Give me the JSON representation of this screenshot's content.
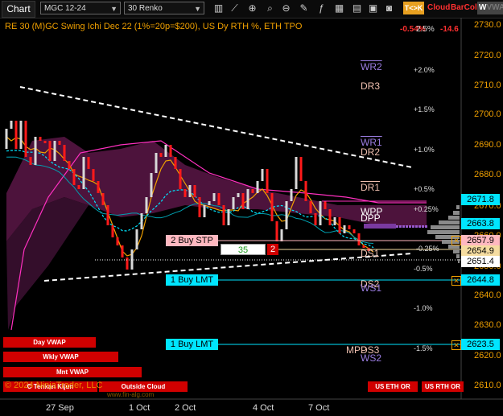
{
  "toolbar": {
    "chart_label": "Chart",
    "symbol": "MGC 12-24",
    "bar_type": "30 Renko",
    "tk_label": "T<>K",
    "cloud_label": "Cloud",
    "barcol_label": "BarCol",
    "vwap_label": "VWAP",
    "icons": [
      "bars-icon",
      "line-chart-icon",
      "crosshair-icon",
      "magnifier-icon",
      "zoom-out-icon",
      "pencil-icon",
      "indicator-icon",
      "grid-icon",
      "template-icon",
      "layout-icon",
      "settings-icon",
      "camera-icon"
    ]
  },
  "header": {
    "title": "RE 30 (M)GC Swing Ichi Dec 22 (1%=20p=$200), US Dy RTH %, ETH TPO",
    "change": "-0.54%",
    "change_overlay": "2.5%",
    "change_pts": "-14.6"
  },
  "price_axis": {
    "labels": [
      "2730.0",
      "2720.0",
      "2710.0",
      "2700.0",
      "2690.0",
      "2680.0",
      "2670.0",
      "2660.0",
      "2650.0",
      "2640.0",
      "2630.0",
      "2620.0",
      "2610.0"
    ],
    "boxes": [
      {
        "value": "2671.8",
        "bg": "#00e5ff",
        "fg": "#000000"
      },
      {
        "value": "2663.8",
        "bg": "#00e5ff",
        "fg": "#000000"
      },
      {
        "value": "2657.9",
        "bg": "#ffb8c0",
        "fg": "#000000"
      },
      {
        "value": "2654.9",
        "bg": "#f5dca0",
        "fg": "#000000"
      },
      {
        "value": "2651.4",
        "bg": "#ffffff",
        "fg": "#000000"
      },
      {
        "value": "2644.8",
        "bg": "#00e5ff",
        "fg": "#000000"
      },
      {
        "value": "2623.5",
        "bg": "#00e5ff",
        "fg": "#000000"
      }
    ]
  },
  "percent_labels": [
    "+2.0%",
    "+1.5%",
    "+1.0%",
    "+0.5%",
    "+0.25%",
    "-0.25%",
    "-0.5%",
    "-1.0%",
    "-1.5%"
  ],
  "levels": {
    "wr2": "WR2",
    "dr3": "DR3",
    "wr1": "WR1",
    "dr2": "DR2",
    "dr1": "DR1",
    "wpp": "WPP",
    "dpp": "DPP",
    "ds1": "DS1",
    "ds2": "DS2",
    "ws1": "WS1",
    "mpp": "MPP",
    "ds3": "DS3",
    "ws2": "WS2"
  },
  "orders": {
    "buy_stp": "2 Buy STP",
    "stp_ticks": "35",
    "stp_qty": "2",
    "buy_lmt_1": "1 Buy LMT",
    "buy_lmt_2": "1 Buy LMT"
  },
  "x_axis": {
    "labels": [
      "27 Sep",
      "1 Oct",
      "2 Oct",
      "4 Oct",
      "7 Oct"
    ]
  },
  "buttons": {
    "day_vwap": "Day VWAP",
    "wkly_vwap": "Wkly VWAP",
    "mnt_vwap": "Mnt VWAP",
    "tenkan_kijun": "C Tenkan Kijun",
    "outside_cloud": "Outside Cloud",
    "us_eth_or": "US ETH OR",
    "us_rth_or": "US RTH OR"
  },
  "copyright": "© 2024 NinjaTrader, LLC",
  "watermark": "www.fin-alg.com",
  "colors": {
    "up_bar": "#d8d8d8",
    "down_bar": "#ff1a1a",
    "accent_orange": "#f0a000",
    "cyan": "#00e5ff",
    "cloud": "#5a1646",
    "magenta": "#ff30c0"
  }
}
